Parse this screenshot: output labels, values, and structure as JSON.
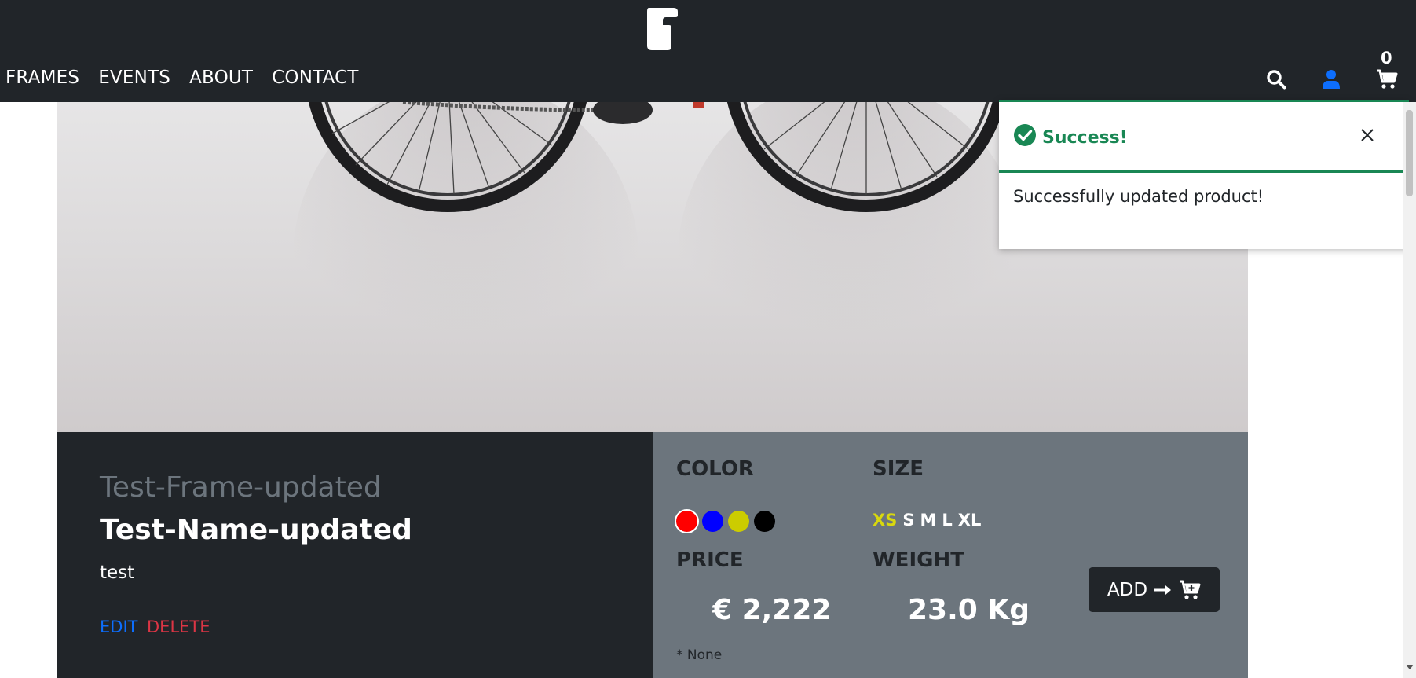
{
  "header": {
    "nav": [
      "FRAMES",
      "EVENTS",
      "ABOUT",
      "CONTACT"
    ],
    "icons": [
      "search-icon",
      "user-icon",
      "cart-icon"
    ],
    "cart_count": "0"
  },
  "product": {
    "frame_name": "Test-Frame-updated",
    "name": "Test-Name-updated",
    "description": "test",
    "edit_label": "EDIT",
    "delete_label": "DELETE",
    "color_label": "COLOR",
    "size_label": "SIZE",
    "colors": [
      "#ff0000",
      "#0000ff",
      "#cccc00",
      "#000000"
    ],
    "sizes": [
      "XS",
      "S",
      "M",
      "L",
      "XL"
    ],
    "selected_size": "XS",
    "price_label": "PRICE",
    "price": "€ 2,222",
    "weight_label": "WEIGHT",
    "weight": "23.0 Kg",
    "note": "* None",
    "add_label": "ADD"
  },
  "toast": {
    "title": "Success!",
    "message": "Successfully updated product!"
  },
  "colors": {
    "dark": "#212529",
    "grey": "#6c757d",
    "success": "#198754",
    "edit": "#0d6efd",
    "delete": "#dc3545",
    "selected_size": "#d8d80e",
    "user_icon": "#0d6efd"
  }
}
